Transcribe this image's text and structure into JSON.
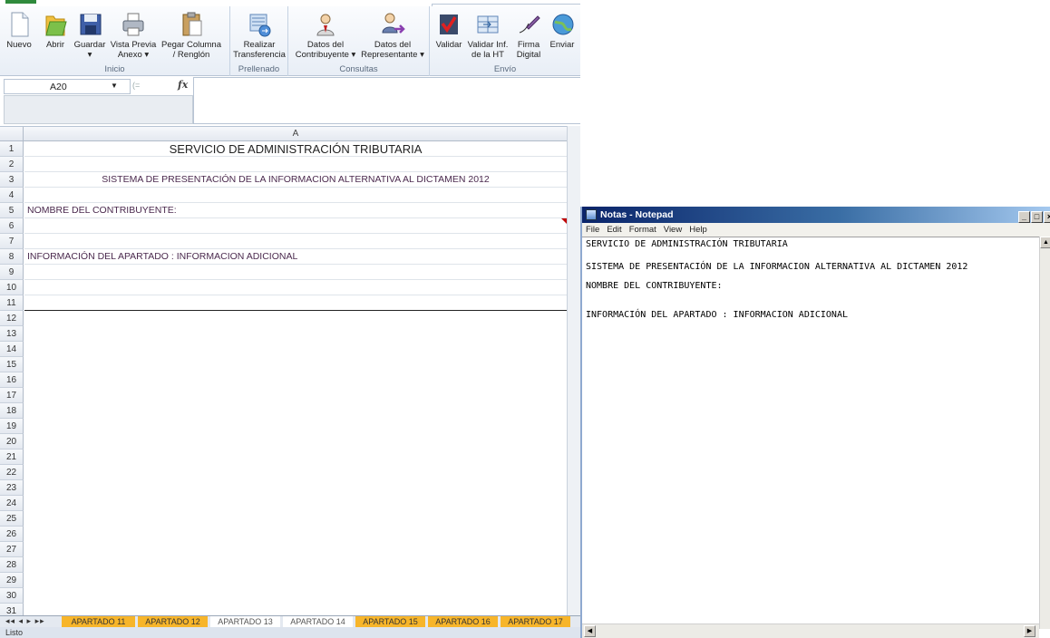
{
  "excel": {
    "ribbon": {
      "groups": [
        {
          "label": "Inicio"
        },
        {
          "label": "Prellenado"
        },
        {
          "label": "Consultas"
        },
        {
          "label": "Envío"
        }
      ],
      "buttons": [
        {
          "label": "Nuevo",
          "icon": "new-document-icon"
        },
        {
          "label": "Abrir",
          "icon": "open-folder-icon"
        },
        {
          "label": "Guardar",
          "sub": "▾",
          "icon": "save-disk-icon"
        },
        {
          "label": "Vista Previa",
          "sub": "Anexo ▾",
          "icon": "print-preview-icon"
        },
        {
          "label": "Pegar Columna",
          "sub": "/ Renglón",
          "icon": "paste-clipboard-icon"
        },
        {
          "label": "Realizar",
          "sub": "Transferencia",
          "icon": "transfer-icon"
        },
        {
          "label": "Datos del",
          "sub": "Contribuyente ▾",
          "icon": "taxpayer-icon"
        },
        {
          "label": "Datos del",
          "sub": "Representante ▾",
          "icon": "representative-icon"
        },
        {
          "label": "Validar",
          "icon": "validate-check-icon"
        },
        {
          "label": "Validar Inf.",
          "sub": "de la HT",
          "icon": "validate-sheet-icon"
        },
        {
          "label": "Firma",
          "sub": "Digital",
          "icon": "digital-signature-icon"
        },
        {
          "label": "Enviar",
          "icon": "send-globe-icon"
        }
      ]
    },
    "namebox": "A20",
    "column_header": "A",
    "rows": [
      {
        "n": "1",
        "text": "SERVICIO DE ADMINISTRACIÓN TRIBUTARIA"
      },
      {
        "n": "2",
        "text": ""
      },
      {
        "n": "3",
        "text": "SISTEMA DE PRESENTACIÓN DE LA INFORMACION ALTERNATIVA AL DICTAMEN 2012"
      },
      {
        "n": "4",
        "text": ""
      },
      {
        "n": "5",
        "text": "NOMBRE DEL CONTRIBUYENTE:"
      },
      {
        "n": "6",
        "text": ""
      },
      {
        "n": "7",
        "text": ""
      },
      {
        "n": "8",
        "text": "INFORMACIÓN DEL APARTADO : INFORMACION ADICIONAL"
      },
      {
        "n": "9",
        "text": ""
      },
      {
        "n": "10",
        "text": ""
      },
      {
        "n": "11",
        "text": ""
      },
      {
        "n": "12",
        "text": ""
      },
      {
        "n": "13",
        "text": ""
      },
      {
        "n": "14",
        "text": ""
      },
      {
        "n": "15",
        "text": ""
      },
      {
        "n": "16",
        "text": ""
      },
      {
        "n": "17",
        "text": ""
      },
      {
        "n": "18",
        "text": ""
      },
      {
        "n": "19",
        "text": ""
      },
      {
        "n": "20",
        "text": ""
      },
      {
        "n": "21",
        "text": ""
      },
      {
        "n": "22",
        "text": ""
      },
      {
        "n": "23",
        "text": ""
      },
      {
        "n": "24",
        "text": ""
      },
      {
        "n": "25",
        "text": ""
      },
      {
        "n": "26",
        "text": ""
      },
      {
        "n": "27",
        "text": ""
      },
      {
        "n": "28",
        "text": ""
      },
      {
        "n": "29",
        "text": ""
      },
      {
        "n": "30",
        "text": ""
      },
      {
        "n": "31",
        "text": ""
      }
    ],
    "tab_nav": "◂◂ ◂ ▸ ▸▸",
    "sheet_tabs": [
      {
        "label": "APARTADO 11",
        "color": "#f7b52a"
      },
      {
        "label": "APARTADO 12",
        "color": "#f7b52a"
      },
      {
        "label": "APARTADO 13",
        "color": "#ffffff"
      },
      {
        "label": "APARTADO 14",
        "color": "#ffffff"
      },
      {
        "label": "APARTADO 15",
        "color": "#f7b52a"
      },
      {
        "label": "APARTADO 16",
        "color": "#f7b52a"
      },
      {
        "label": "APARTADO 17",
        "color": "#f7b52a"
      }
    ],
    "status": "Listo"
  },
  "notepad": {
    "title": "Notas - Notepad",
    "menu": [
      "File",
      "Edit",
      "Format",
      "View",
      "Help"
    ],
    "controls": [
      "_",
      "□",
      "×"
    ],
    "lines": [
      "SERVICIO DE ADMINISTRACIÓN TRIBUTARIA",
      "SISTEMA DE PRESENTACIÓN DE LA INFORMACION ALTERNATIVA AL DICTAMEN 2012",
      "NOMBRE DEL CONTRIBUYENTE:",
      "INFORMACIÓN DEL APARTADO : INFORMACION ADICIONAL"
    ]
  }
}
